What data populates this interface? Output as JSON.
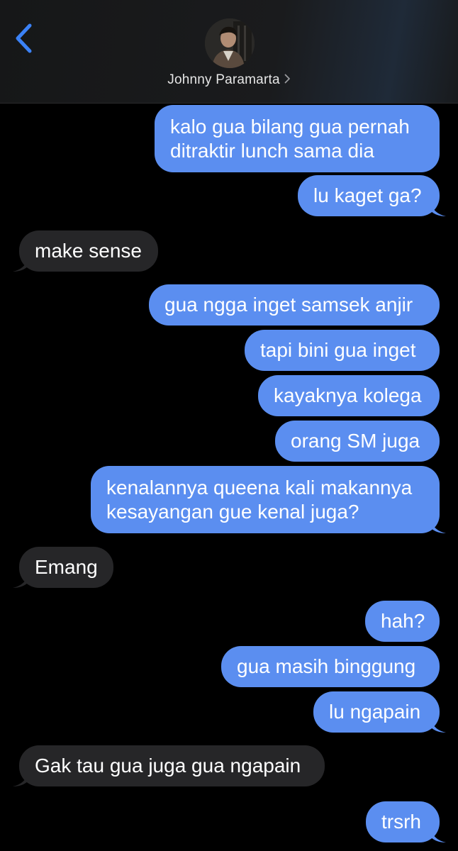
{
  "header": {
    "contact_name": "Johnny Paramarta",
    "back_icon": "chevron-left-icon",
    "detail_icon": "chevron-right-icon"
  },
  "colors": {
    "outgoing_bubble": "#5b8ef0",
    "incoming_bubble": "#262628",
    "back_accent": "#3b82f6"
  },
  "messages": [
    {
      "dir": "out",
      "text": "kalo gua bilang gua pernah ditraktir lunch sama dia"
    },
    {
      "dir": "out",
      "text": "lu kaget ga?"
    },
    {
      "dir": "in",
      "text": "make sense"
    },
    {
      "dir": "out",
      "text": "gua ngga inget samsek anjir"
    },
    {
      "dir": "out",
      "text": "tapi bini gua inget"
    },
    {
      "dir": "out",
      "text": "kayaknya kolega"
    },
    {
      "dir": "out",
      "text": "orang SM juga"
    },
    {
      "dir": "out",
      "text": "kenalannya queena kali makannya kesayangan gue kenal juga?"
    },
    {
      "dir": "in",
      "text": "Emang"
    },
    {
      "dir": "out",
      "text": "hah?"
    },
    {
      "dir": "out",
      "text": "gua masih binggung"
    },
    {
      "dir": "out",
      "text": "lu ngapain"
    },
    {
      "dir": "in",
      "text": "Gak tau gua juga gua ngapain"
    },
    {
      "dir": "out",
      "text": "trsrh"
    }
  ]
}
